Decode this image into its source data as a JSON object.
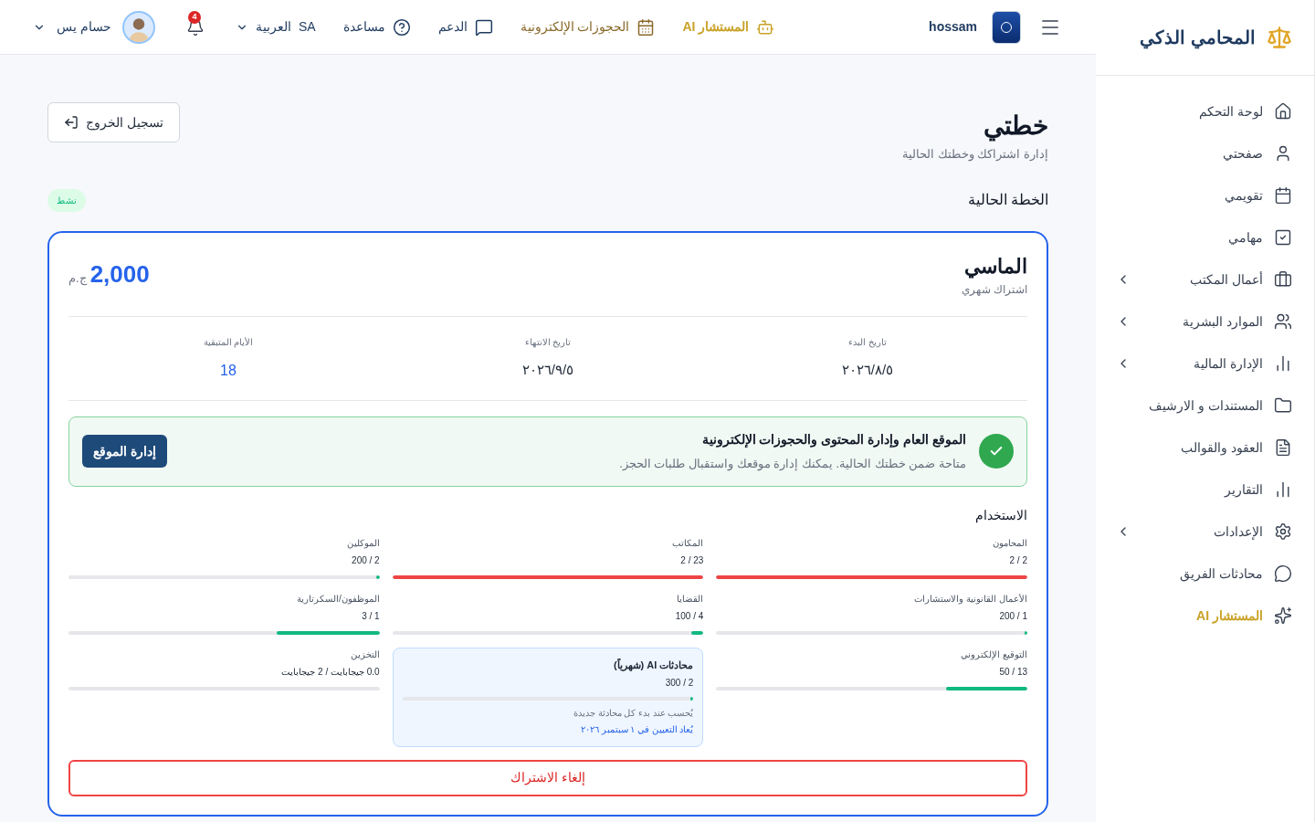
{
  "sidebar": {
    "brand": "المحامي الذكي",
    "items": [
      {
        "label": "لوحة التحكم",
        "expandable": false,
        "accent": false
      },
      {
        "label": "صفحتي",
        "expandable": false,
        "accent": false
      },
      {
        "label": "تقويمي",
        "expandable": false,
        "accent": false
      },
      {
        "label": "مهامي",
        "expandable": false,
        "accent": false
      },
      {
        "label": "أعمال المكتب",
        "expandable": true,
        "accent": false
      },
      {
        "label": "الموارد البشرية",
        "expandable": true,
        "accent": false
      },
      {
        "label": "الإدارة المالية",
        "expandable": true,
        "accent": false
      },
      {
        "label": "المستندات و الارشيف",
        "expandable": false,
        "accent": false
      },
      {
        "label": "العقود والقوالب",
        "expandable": false,
        "accent": false
      },
      {
        "label": "التقارير",
        "expandable": false,
        "accent": false
      },
      {
        "label": "الإعدادات",
        "expandable": true,
        "accent": false
      },
      {
        "label": "محادثات الفريق",
        "expandable": false,
        "accent": false
      },
      {
        "label": "المستشار AI",
        "expandable": false,
        "accent": true
      }
    ]
  },
  "header": {
    "account": "hossam",
    "nav": [
      {
        "label": "المستشار AI",
        "color": "#c9a227"
      },
      {
        "label": "الحجوزات الإلكترونية",
        "color": "#8a6a2b"
      },
      {
        "label": "الدعم",
        "color": "#1e3a5f"
      },
      {
        "label": "مساعدة",
        "color": "#1e3a5f"
      }
    ],
    "language": {
      "code": "SA",
      "label": "العربية"
    },
    "notifications": "4",
    "user": "حسام يس"
  },
  "page": {
    "title": "خطتي",
    "subtitle": "إدارة اشتراكك وخطتك الحالية",
    "logout": "تسجيل الخروج",
    "section": "الخطة الحالية",
    "status": "نشط"
  },
  "plan": {
    "name": "الماسي",
    "period": "اشتراك شهري",
    "price": "2,000",
    "currency": "ج.م",
    "facts": [
      {
        "label": "تاريخ البدء",
        "value": "٢٠٢٦/٨/٥",
        "highlight": false
      },
      {
        "label": "تاريخ الانتهاء",
        "value": "٢٠٢٦/٩/٥",
        "highlight": false
      },
      {
        "label": "الأيام المتبقية",
        "value": "18",
        "highlight": true
      }
    ],
    "feature": {
      "title": "الموقع العام وإدارة المحتوى والحجوزات الإلكترونية",
      "text": "متاحة ضمن خطتك الحالية. يمكنك إدارة موقعك واستقبال طلبات الحجز.",
      "button": "إدارة الموقع"
    },
    "usage_title": "الاستخدام",
    "usage": [
      {
        "label": "المحامون",
        "reading": "2 / 2",
        "level": 1,
        "color": "#ef4444",
        "highlight": false
      },
      {
        "label": "المكاتب",
        "reading": "23 / 2",
        "level": 1,
        "color": "#ef4444",
        "highlight": false
      },
      {
        "label": "الموكلين",
        "reading": "2 / 200",
        "level": 0.01,
        "color": "#10b981",
        "highlight": false
      },
      {
        "label": "الأعمال القانونية والاستشارات",
        "reading": "1 / 200",
        "level": 0.005,
        "color": "#10b981",
        "highlight": false
      },
      {
        "label": "القضايا",
        "reading": "4 / 100",
        "level": 0.04,
        "color": "#10b981",
        "highlight": false
      },
      {
        "label": "الموظفون/السكرتارية",
        "reading": "1 / 3",
        "level": 0.33,
        "color": "#10b981",
        "highlight": false
      },
      {
        "label": "التوقيع الإلكتروني",
        "reading": "13 / 50",
        "level": 0.26,
        "color": "#10b981",
        "highlight": false
      },
      {
        "label": "محادثات AI (شهرياً)",
        "reading": "2 / 300",
        "level": 0.007,
        "color": "#10b981",
        "highlight": true,
        "note": "يُحسب عند بدء كل محادثة جديدة",
        "reset": "يُعاد التعيين في ١ سبتمبر ٢٠٢٦"
      },
      {
        "label": "التخزين",
        "reading": "0.0 جيجابايت / 2 جيجابايت",
        "highlight": false
      }
    ],
    "cancel": "إلغاء الاشتراك"
  }
}
